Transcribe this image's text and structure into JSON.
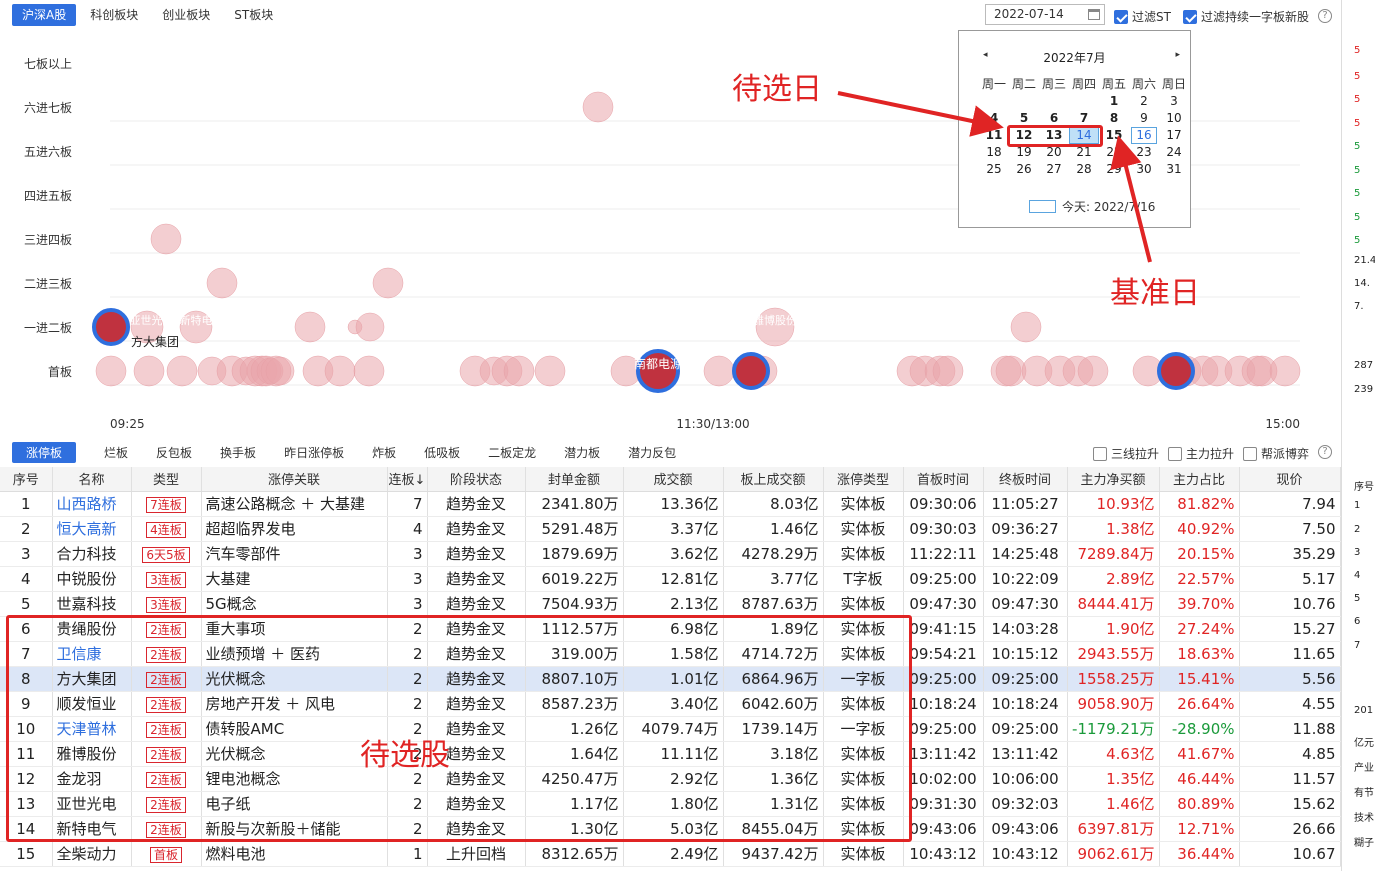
{
  "market_tabs": [
    "沪深A股",
    "科创板块",
    "创业板块",
    "ST板块"
  ],
  "date_value": "2022-07-14",
  "filters": {
    "filter_st": "过滤ST",
    "filter_yizi": "过滤持续一字板新股",
    "three_line": "三线拉升",
    "main_force": "主力拉升",
    "gang_game": "帮派博弈",
    "help": "?"
  },
  "chart": {
    "levels": [
      "七板以上",
      "六进七板",
      "五进六板",
      "四进五板",
      "三进四板",
      "二进三板",
      "一进二板",
      "首板"
    ],
    "times": [
      "09:25",
      "11:30/13:00",
      "15:00"
    ],
    "labels": {
      "fangda": "方大集团",
      "nandu": "南都电源",
      "yashi": "亚世光",
      "xinte": "新特电",
      "yabo": "雅博股份"
    },
    "colors": {
      "bubble": "#e9a6ac",
      "highlight": "#c0323f",
      "ring": "#2f6fde"
    }
  },
  "calendar": {
    "title": "2022年7月",
    "prev": "◂",
    "next": "▸",
    "weekdays": [
      "周一",
      "周二",
      "周三",
      "周四",
      "周五",
      "周六",
      "周日"
    ],
    "days": [
      "",
      "",
      "",
      "",
      "1",
      "2",
      "3",
      "4",
      "5",
      "6",
      "7",
      "8",
      "9",
      "10",
      "11",
      "12",
      "13",
      "14",
      "15",
      "16",
      "17",
      "18",
      "19",
      "20",
      "21",
      "22",
      "23",
      "24",
      "25",
      "26",
      "27",
      "28",
      "29",
      "30",
      "31"
    ],
    "today_label": "今天: 2022/7/16"
  },
  "annotations": {
    "pending_day": "待选日",
    "base_day": "基准日",
    "pending_stocks": "待选股"
  },
  "sub_tabs": [
    "涨停板",
    "烂板",
    "反包板",
    "换手板",
    "昨日涨停板",
    "炸板",
    "低吸板",
    "二板定龙",
    "潜力板",
    "潜力反包"
  ],
  "columns": [
    "序号",
    "名称",
    "类型",
    "涨停关联",
    "连板↓",
    "阶段状态",
    "封单金额",
    "成交额",
    "板上成交额",
    "涨停类型",
    "首板时间",
    "终板时间",
    "主力净买额",
    "主力占比",
    "现价"
  ],
  "rows": [
    [
      "1",
      "山西路桥",
      "7连板",
      "高速公路概念 ＋ 大基建",
      "7",
      "趋势金叉",
      "2341.80万",
      "13.36亿",
      "8.03亿",
      "实体板",
      "09:30:06",
      "11:05:27",
      "10.93亿",
      "81.82%",
      "7.94"
    ],
    [
      "2",
      "恒大高新",
      "4连板",
      "超超临界发电",
      "4",
      "趋势金叉",
      "5291.48万",
      "3.37亿",
      "1.46亿",
      "实体板",
      "09:30:03",
      "09:36:27",
      "1.38亿",
      "40.92%",
      "7.50"
    ],
    [
      "3",
      "合力科技",
      "6天5板",
      "汽车零部件",
      "3",
      "趋势金叉",
      "1879.69万",
      "3.62亿",
      "4278.29万",
      "实体板",
      "11:22:11",
      "14:25:48",
      "7289.84万",
      "20.15%",
      "35.29"
    ],
    [
      "4",
      "中锐股份",
      "3连板",
      "大基建",
      "3",
      "趋势金叉",
      "6019.22万",
      "12.81亿",
      "3.77亿",
      "T字板",
      "09:25:00",
      "10:22:09",
      "2.89亿",
      "22.57%",
      "5.17"
    ],
    [
      "5",
      "世嘉科技",
      "3连板",
      "5G概念",
      "3",
      "趋势金叉",
      "7504.93万",
      "2.13亿",
      "8787.63万",
      "实体板",
      "09:47:30",
      "09:47:30",
      "8444.41万",
      "39.70%",
      "10.76"
    ],
    [
      "6",
      "贵绳股份",
      "2连板",
      "重大事项",
      "2",
      "趋势金叉",
      "1112.57万",
      "6.98亿",
      "1.89亿",
      "实体板",
      "09:41:15",
      "14:03:28",
      "1.90亿",
      "27.24%",
      "15.27"
    ],
    [
      "7",
      "卫信康",
      "2连板",
      "业绩预增 ＋ 医药",
      "2",
      "趋势金叉",
      "319.00万",
      "1.58亿",
      "4714.72万",
      "实体板",
      "09:54:21",
      "10:15:12",
      "2943.55万",
      "18.63%",
      "11.65"
    ],
    [
      "8",
      "方大集团",
      "2连板",
      "光伏概念",
      "2",
      "趋势金叉",
      "8807.10万",
      "1.01亿",
      "6864.96万",
      "一字板",
      "09:25:00",
      "09:25:00",
      "1558.25万",
      "15.41%",
      "5.56"
    ],
    [
      "9",
      "顺发恒业",
      "2连板",
      "房地产开发 ＋ 风电",
      "2",
      "趋势金叉",
      "8587.23万",
      "3.40亿",
      "6042.60万",
      "实体板",
      "10:18:24",
      "10:18:24",
      "9058.90万",
      "26.64%",
      "4.55"
    ],
    [
      "10",
      "天津普林",
      "2连板",
      "债转股AMC",
      "2",
      "趋势金叉",
      "1.26亿",
      "4079.74万",
      "1739.14万",
      "一字板",
      "09:25:00",
      "09:25:00",
      "-1179.21万",
      "-28.90%",
      "11.88"
    ],
    [
      "11",
      "雅博股份",
      "2连板",
      "光伏概念",
      "2",
      "趋势金叉",
      "1.64亿",
      "11.11亿",
      "3.18亿",
      "实体板",
      "13:11:42",
      "13:11:42",
      "4.63亿",
      "41.67%",
      "4.85"
    ],
    [
      "12",
      "金龙羽",
      "2连板",
      "锂电池概念",
      "2",
      "趋势金叉",
      "4250.47万",
      "2.92亿",
      "1.36亿",
      "实体板",
      "10:02:00",
      "10:06:00",
      "1.35亿",
      "46.44%",
      "11.57"
    ],
    [
      "13",
      "亚世光电",
      "2连板",
      "电子纸",
      "2",
      "趋势金叉",
      "1.17亿",
      "1.80亿",
      "1.31亿",
      "实体板",
      "09:31:30",
      "09:32:03",
      "1.46亿",
      "80.89%",
      "15.62"
    ],
    [
      "14",
      "新特电气",
      "2连板",
      "新股与次新股＋储能",
      "2",
      "趋势金叉",
      "1.30亿",
      "5.03亿",
      "8455.04万",
      "实体板",
      "09:43:06",
      "09:43:06",
      "6397.81万",
      "12.71%",
      "26.66"
    ],
    [
      "15",
      "全柴动力",
      "首板",
      "燃料电池",
      "1",
      "上升回档",
      "8312.65万",
      "2.49亿",
      "9437.42万",
      "实体板",
      "10:43:12",
      "10:43:12",
      "9062.61万",
      "36.44%",
      "10.67"
    ]
  ],
  "right_panel": [
    "5",
    "5",
    "5",
    "5",
    "5",
    "5",
    "5",
    "5",
    "5",
    "21.4",
    "14.",
    "7.",
    "287",
    "239",
    "序号",
    "1",
    "2",
    "3",
    "4",
    "5",
    "6",
    "7",
    "201",
    "亿元",
    "产业",
    "有节",
    "技术",
    "糊子"
  ]
}
